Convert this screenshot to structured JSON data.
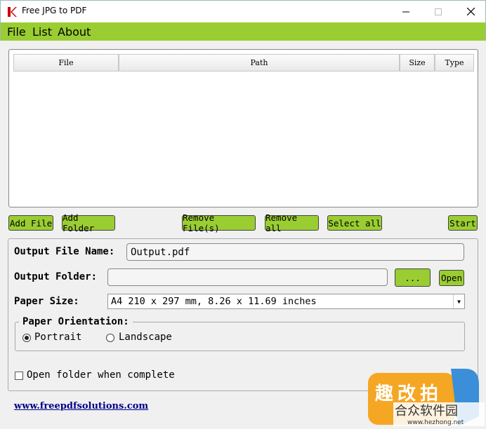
{
  "window": {
    "title": "Free JPG to PDF",
    "controls": [
      "minimize",
      "maximize",
      "close"
    ]
  },
  "menu": [
    "File",
    "List",
    "About"
  ],
  "file_list": {
    "columns": [
      "File",
      "Path",
      "Size",
      "Type"
    ],
    "rows": []
  },
  "list_buttons": {
    "add_file": "Add File",
    "add_folder": "Add Folder",
    "remove_files": "Remove File(s)",
    "remove_all": "Remove all",
    "select_all": "Select all",
    "start": "Start"
  },
  "settings": {
    "output_file_label": "Output File Name:",
    "output_file_value": "Output.pdf",
    "output_folder_label": "Output Folder:",
    "output_folder_value": "",
    "browse_label": "...",
    "open_label": "Open",
    "paper_size_label": "Paper Size:",
    "paper_size_value": "A4 210 x 297 mm, 8.26 x 11.69 inches",
    "orientation_label": "Paper Orientation:",
    "orientation_options": [
      "Portrait",
      "Landscape"
    ],
    "orientation_selected": "Portrait",
    "open_folder_label": "Open folder when complete",
    "open_folder_checked": false
  },
  "footer_link": "www.freepdfsolutions.com",
  "watermark": {
    "text_cn": "合众软件园",
    "url": "www.hezhong.net"
  },
  "colors": {
    "accent_green": "#9acd32",
    "link": "#00008b"
  }
}
